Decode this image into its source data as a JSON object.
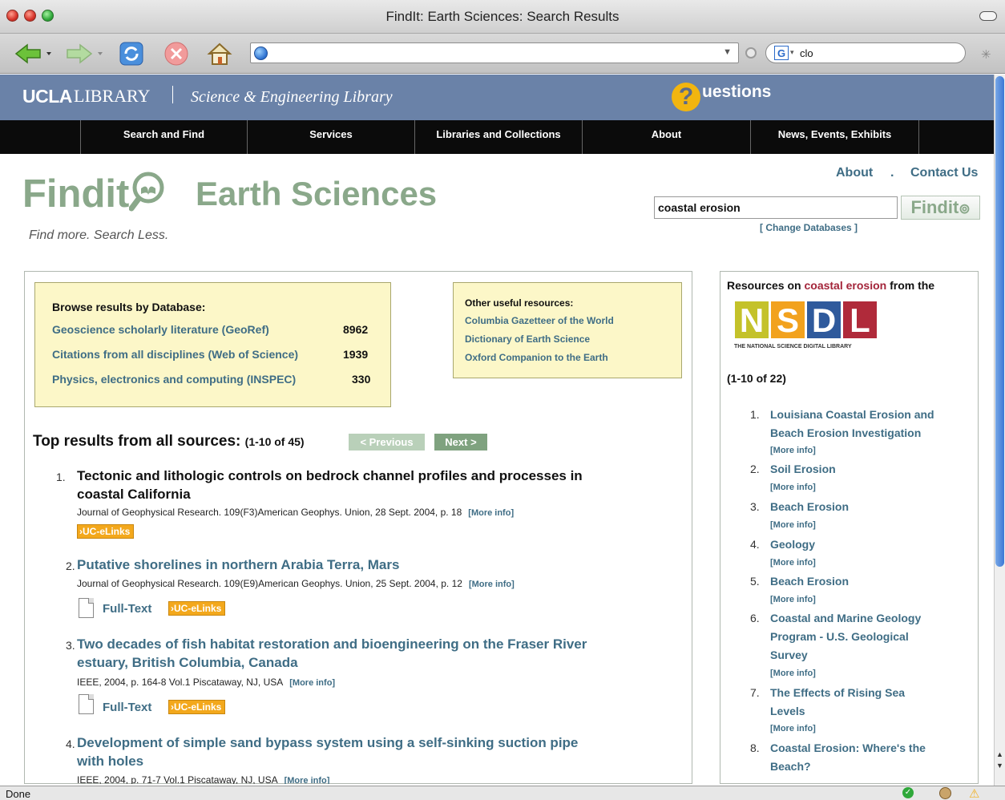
{
  "window": {
    "title": "FindIt: Earth Sciences: Search Results"
  },
  "browser": {
    "url": "",
    "search_engine_icon": "google-icon",
    "search_value": "clo",
    "status": "Done"
  },
  "library_bar": {
    "ucla": "UCLA",
    "library": "LIBRARY",
    "sub_library": "Science & Engineering Library",
    "questions_q": "?",
    "questions_text": "uestions"
  },
  "nav": [
    "Search and Find",
    "Services",
    "Libraries and Collections",
    "About",
    "News, Events, Exhibits"
  ],
  "logo": {
    "findit": "Findit",
    "earth_sciences": "Earth Sciences",
    "tagline": "Find more. Search Less."
  },
  "top_links": {
    "about": "About",
    "separator": ".",
    "contact": "Contact Us"
  },
  "search": {
    "query": "coastal erosion",
    "button": "Findit",
    "change_databases": "[ Change Databases ]"
  },
  "databases": {
    "title": "Browse results by Database:",
    "items": [
      {
        "name": "Geoscience scholarly literature (GeoRef)",
        "count": "8962"
      },
      {
        "name": "Citations from all disciplines (Web of Science)",
        "count": "1939"
      },
      {
        "name": "Physics, electronics and computing (INSPEC)",
        "count": "330"
      }
    ]
  },
  "other_resources": {
    "title": "Other useful resources:",
    "links": [
      "Columbia Gazetteer of the World",
      "Dictionary of Earth Science",
      "Oxford Companion to the Earth"
    ]
  },
  "top_results": {
    "title": "Top results from all sources:",
    "range": "(1-10 of 45)",
    "previous": "< Previous",
    "next": "Next >",
    "items": [
      {
        "num": "1.",
        "title_line1": "Tectonic and lithologic controls on bedrock channel profiles and processes in",
        "title_line2": "coastal California",
        "meta": "Journal of Geophysical Research. 109(F3)American Geophys. Union, 28 Sept. 2004, p. 18",
        "more": "[More info]",
        "uc": "UC-eLinks"
      },
      {
        "num": "2.",
        "title_line1": "Putative shorelines in northern Arabia Terra, Mars",
        "meta": "Journal of Geophysical Research. 109(E9)American Geophys. Union, 25 Sept. 2004, p. 12",
        "more": "[More info]",
        "fulltext": "Full-Text",
        "uc": "UC-eLinks"
      },
      {
        "num": "3.",
        "title_line1": "Two decades of fish habitat restoration and bioengineering on the Fraser River",
        "title_line2": "estuary, British Columbia, Canada",
        "meta": "IEEE, 2004, p. 164-8 Vol.1 Piscataway, NJ, USA",
        "more": "[More info]",
        "fulltext": "Full-Text",
        "uc": "UC-eLinks"
      },
      {
        "num": "4.",
        "title_line1": "Development of simple sand bypass system using a self-sinking suction pipe",
        "title_line2": "with holes",
        "meta": "IEEE, 2004, p. 71-7 Vol.1 Piscataway, NJ, USA",
        "more": "[More info]"
      }
    ]
  },
  "sidebar": {
    "head_prefix": "Resources on",
    "head_query": "coastal erosion",
    "head_suffix": "from the",
    "nsdl_letters": [
      "N",
      "S",
      "D",
      "L"
    ],
    "nsdl_colors": [
      "#c4c22a",
      "#f2a21e",
      "#2f5a9c",
      "#b02a3a"
    ],
    "nsdl_sub": "THE NATIONAL SCIENCE DIGITAL LIBRARY",
    "range": "(1-10 of 22)",
    "more": "[More info]",
    "items": [
      {
        "num": "1.",
        "lines": [
          "Louisiana Coastal Erosion and",
          "Beach Erosion Investigation"
        ]
      },
      {
        "num": "2.",
        "lines": [
          "Soil Erosion"
        ]
      },
      {
        "num": "3.",
        "lines": [
          "Beach Erosion"
        ]
      },
      {
        "num": "4.",
        "lines": [
          "Geology"
        ]
      },
      {
        "num": "5.",
        "lines": [
          "Beach Erosion"
        ]
      },
      {
        "num": "6.",
        "lines": [
          "Coastal and Marine Geology",
          "Program - U.S. Geological",
          "Survey"
        ]
      },
      {
        "num": "7.",
        "lines": [
          "The Effects of Rising Sea",
          "Levels"
        ]
      },
      {
        "num": "8.",
        "lines": [
          "Coastal Erosion: Where's the",
          "Beach?"
        ]
      }
    ]
  },
  "colors": {
    "link": "#3f6d85",
    "library_bar": "#6a82a8",
    "logo_green": "#8aa88a",
    "highlight": "#fcf7c8",
    "query_red": "#a3253a"
  }
}
